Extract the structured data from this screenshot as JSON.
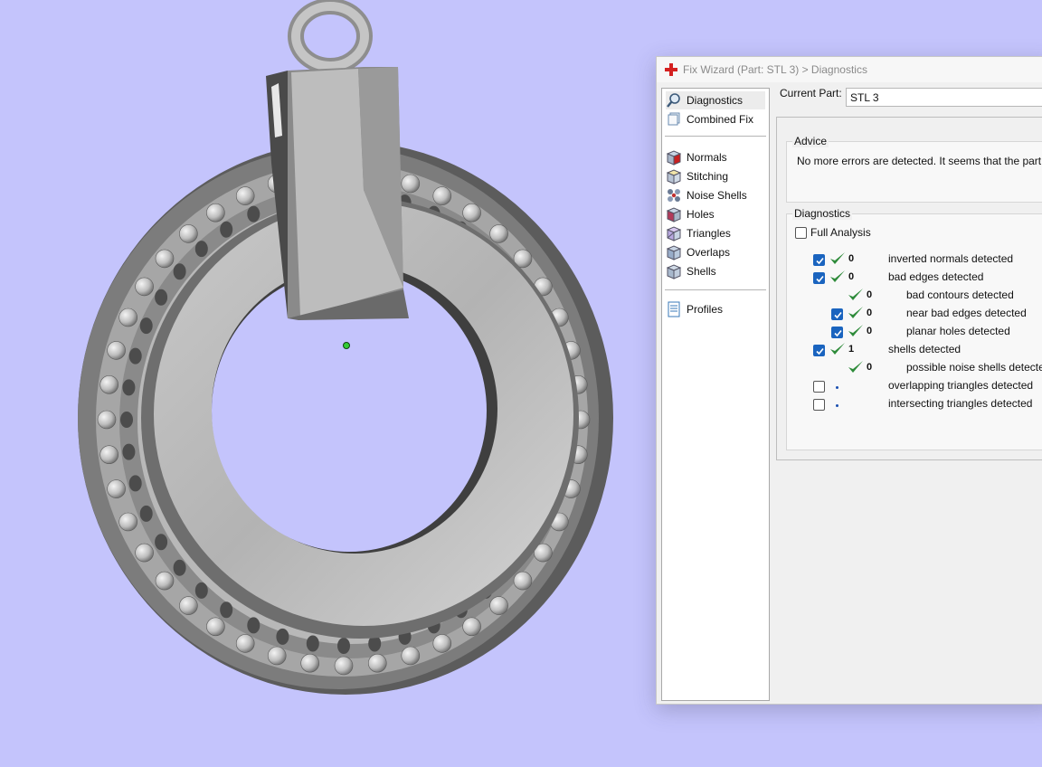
{
  "dialog": {
    "title": "Fix Wizard (Part: STL 3) > Diagnostics"
  },
  "nav": {
    "items": [
      {
        "label": "Diagnostics",
        "icon": "magnifier-icon",
        "selected": true
      },
      {
        "label": "Combined Fix",
        "icon": "stacked-sheets-icon"
      },
      {
        "label": "Normals",
        "icon": "normals-cube-icon"
      },
      {
        "label": "Stitching",
        "icon": "stitching-cube-icon"
      },
      {
        "label": "Noise Shells",
        "icon": "noise-shells-icon"
      },
      {
        "label": "Holes",
        "icon": "holes-cube-icon"
      },
      {
        "label": "Triangles",
        "icon": "triangles-cube-icon"
      },
      {
        "label": "Overlaps",
        "icon": "overlaps-cube-icon"
      },
      {
        "label": "Shells",
        "icon": "shells-cube-icon"
      },
      {
        "label": "Profiles",
        "icon": "document-icon"
      }
    ]
  },
  "current_part": {
    "label": "Current Part:",
    "value": "STL 3"
  },
  "advice": {
    "legend": "Advice",
    "text": "No more errors are detected. It seems that the part is ok"
  },
  "diagnostics": {
    "legend": "Diagnostics",
    "full_analysis_label": "Full Analysis",
    "full_analysis_checked": false,
    "rows": [
      {
        "count": "0",
        "label": "inverted normals detected",
        "checked": true,
        "ok": true
      },
      {
        "count": "0",
        "label": "bad edges detected",
        "checked": true,
        "ok": true
      },
      {
        "count": "0",
        "label": "bad contours detected",
        "checked": null,
        "ok": true
      },
      {
        "count": "0",
        "label": "near bad edges detected",
        "checked": true,
        "ok": true
      },
      {
        "count": "0",
        "label": "planar holes detected",
        "checked": true,
        "ok": true
      },
      {
        "count": "1",
        "label": "shells detected",
        "checked": true,
        "ok": true
      },
      {
        "count": "0",
        "label": "possible noise shells detected",
        "checked": null,
        "ok": true
      },
      {
        "count": "",
        "label": "overlapping triangles detected",
        "checked": false,
        "ok": false
      },
      {
        "count": "",
        "label": "intersecting triangles detected",
        "checked": false,
        "ok": false
      }
    ]
  },
  "colors": {
    "viewport_background": "#c4c4fc",
    "accent_checkbox": "#1a64bf",
    "ok_check": "#2e8b3a",
    "title_icon": "#d42020"
  }
}
